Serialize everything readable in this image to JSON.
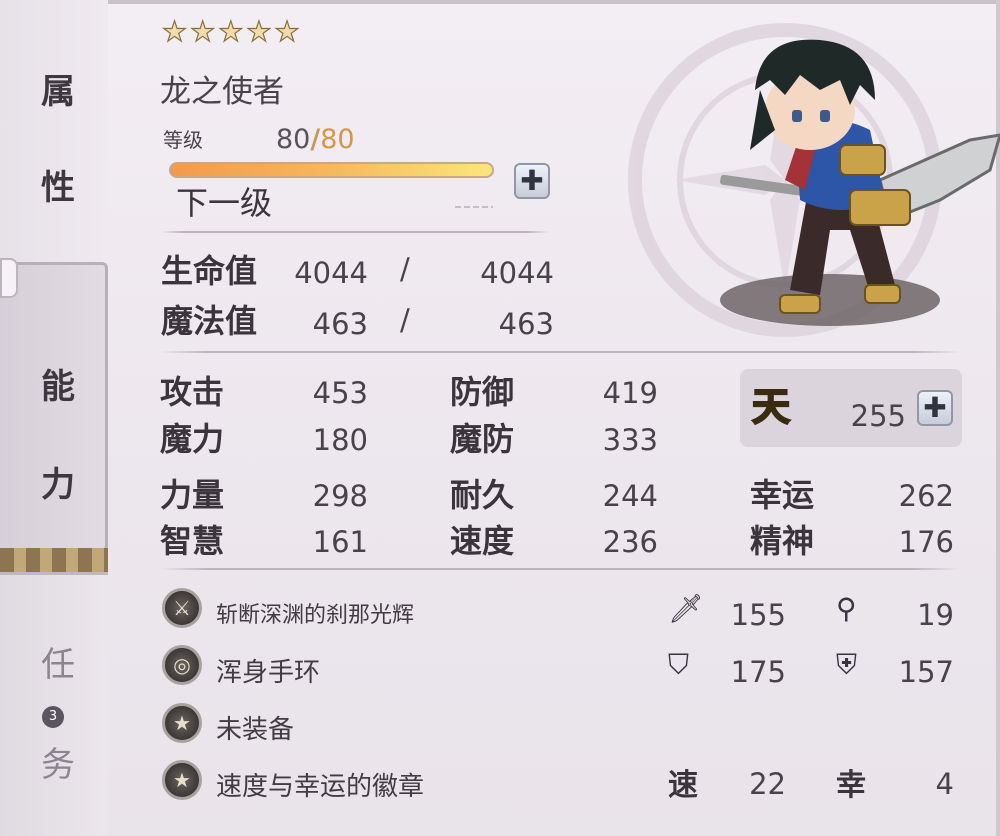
{
  "tabs": {
    "attributes": [
      "属",
      "性"
    ],
    "ability": [
      "能",
      "力"
    ],
    "quest": [
      "任",
      "务"
    ],
    "quest_badge": "3"
  },
  "hero": {
    "stars": 5,
    "name": "龙之使者",
    "level_label": "等级",
    "level": "80",
    "level_max": "80",
    "exp_progress": 1.0,
    "next_level_label": "下一级",
    "hp_label": "生命值",
    "hp": "4044",
    "hp_max": "4044",
    "mp_label": "魔法值",
    "mp": "463",
    "mp_max": "463",
    "slash": "/"
  },
  "stats": {
    "attack_label": "攻击",
    "attack": "453",
    "defense_label": "防御",
    "defense": "419",
    "magic_label": "魔力",
    "magic": "180",
    "mdef_label": "魔防",
    "mdef": "333",
    "strength_label": "力量",
    "strength": "298",
    "endurance_label": "耐久",
    "endurance": "244",
    "luck_label": "幸运",
    "luck": "262",
    "wisdom_label": "智慧",
    "wisdom": "161",
    "speed_label": "速度",
    "speed": "236",
    "spirit_label": "精神",
    "spirit": "176",
    "heaven_glyph": "天",
    "heaven_points": "255"
  },
  "equipment": [
    {
      "name": "斩断深渊的刹那光辉",
      "icon": "sword-icon",
      "stat1_icon": "attack-icon",
      "stat1": "155",
      "stat2_icon": "staff-icon",
      "stat2": "19"
    },
    {
      "name": "浑身手环",
      "icon": "bracelet-icon",
      "stat1_icon": "defense-shield-icon",
      "stat1": "175",
      "stat2_icon": "magic-shield-icon",
      "stat2": "157"
    },
    {
      "name": "未装备",
      "icon": "badge-star-icon"
    },
    {
      "name": "速度与幸运的徽章",
      "icon": "badge-star-icon",
      "stat1_label": "速",
      "stat1": "22",
      "stat2_label": "幸",
      "stat2": "4"
    }
  ],
  "colors": {
    "accent": "#d6964a",
    "bar_start": "#f39a4a",
    "bar_end": "#fbe67a",
    "heaven": "#f6d23a"
  }
}
